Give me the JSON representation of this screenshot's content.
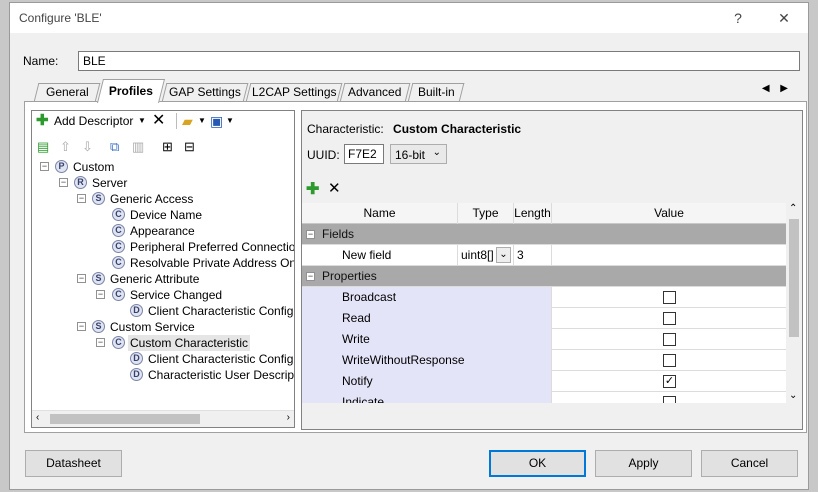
{
  "window": {
    "title": "Configure 'BLE'",
    "help_glyph": "?",
    "close_glyph": "✕"
  },
  "name_field": {
    "label": "Name:",
    "value": "BLE"
  },
  "tabs": [
    {
      "label": "General"
    },
    {
      "label": "Profiles"
    },
    {
      "label": "GAP Settings"
    },
    {
      "label": "L2CAP Settings"
    },
    {
      "label": "Advanced"
    },
    {
      "label": "Built-in"
    }
  ],
  "active_tab": "Profiles",
  "tab_scroll_arrows": "◀ ▶",
  "left_toolbar": {
    "add_descriptor": "Add Descriptor",
    "delete_glyph": "✕"
  },
  "tree": [
    {
      "label": "Custom",
      "badge": "P",
      "level": 0,
      "expander": "−"
    },
    {
      "label": "Server",
      "badge": "R",
      "level": 1,
      "expander": "−"
    },
    {
      "label": "Generic Access",
      "badge": "S",
      "level": 2,
      "expander": "−"
    },
    {
      "label": "Device Name",
      "badge": "C",
      "level": 3
    },
    {
      "label": "Appearance",
      "badge": "C",
      "level": 3
    },
    {
      "label": "Peripheral Preferred Connection",
      "badge": "C",
      "level": 3
    },
    {
      "label": "Resolvable Private Address Only",
      "badge": "C",
      "level": 3
    },
    {
      "label": "Generic Attribute",
      "badge": "S",
      "level": 2,
      "expander": "−"
    },
    {
      "label": "Service Changed",
      "badge": "C",
      "level": 3,
      "expander": "−"
    },
    {
      "label": "Client Characteristic Configu",
      "badge": "D",
      "level": 4
    },
    {
      "label": "Custom Service",
      "badge": "S",
      "level": 2,
      "expander": "−"
    },
    {
      "label": "Custom Characteristic",
      "badge": "C",
      "level": 3,
      "expander": "−",
      "selected": true
    },
    {
      "label": "Client Characteristic Configu",
      "badge": "D",
      "level": 4
    },
    {
      "label": "Characteristic User Descript",
      "badge": "D",
      "level": 4
    }
  ],
  "characteristic": {
    "label": "Characteristic:",
    "name": "Custom Characteristic",
    "uuid_label": "UUID:",
    "uuid_value": "F7E2",
    "uuid_type": "16-bit"
  },
  "grid": {
    "headers": {
      "name": "Name",
      "type": "Type",
      "length": "Length",
      "value": "Value"
    },
    "fields_category": "Fields",
    "field_row": {
      "name": "New field",
      "type": "uint8[]",
      "length": "3"
    },
    "properties_category": "Properties",
    "properties": [
      {
        "name": "Broadcast",
        "checked": false
      },
      {
        "name": "Read",
        "checked": false
      },
      {
        "name": "Write",
        "checked": false
      },
      {
        "name": "WriteWithoutResponse",
        "checked": false
      },
      {
        "name": "Notify",
        "checked": true
      },
      {
        "name": "Indicate",
        "checked": false
      }
    ]
  },
  "buttons": {
    "datasheet": "Datasheet",
    "ok": "OK",
    "apply": "Apply",
    "cancel": "Cancel"
  }
}
